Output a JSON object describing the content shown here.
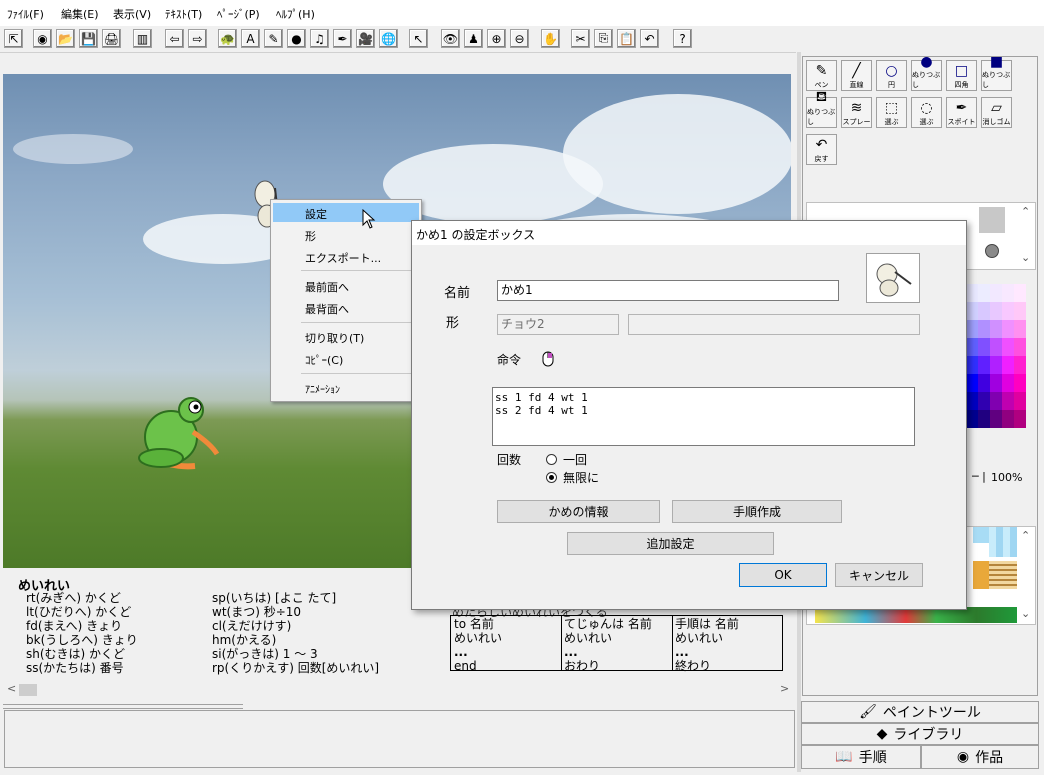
{
  "menu": [
    "ﾌｧｲﾙ(F)",
    "編集(E)",
    "表示(V)",
    "ﾃｷｽﾄ(T)",
    "ﾍﾟｰｼﾞ(P)",
    "ﾍﾙﾌﾟ(H)"
  ],
  "toolbar_icons": [
    "pointer-icon",
    "new-page-icon",
    "open-icon",
    "save-icon",
    "print-icon",
    "book-icon",
    "back-icon",
    "forward-icon",
    "turtle-icon",
    "text-icon",
    "paint-icon",
    "eye-icon",
    "music-icon",
    "pen-icon",
    "movie-icon",
    "globe-icon",
    "select-icon",
    "view-icon",
    "person-icon",
    "zoom-in-icon",
    "zoom-out-icon",
    "stop-icon",
    "cut-icon",
    "copy-icon",
    "paste-icon",
    "undo-icon",
    "help-icon"
  ],
  "toolbar_glyphs": [
    "⇱",
    "◉",
    "📂",
    "💾",
    "🖨",
    "▥",
    "⇦",
    "⇨",
    "🐢",
    "A",
    "✎",
    "●",
    "♫",
    "✒",
    "🎥",
    "🌐",
    "↖",
    "👁",
    "♟",
    "⊕",
    "⊖",
    "✋",
    "✂",
    "⎘",
    "📋",
    "↶",
    "?"
  ],
  "context_menu": {
    "items": [
      "設定",
      "形",
      "エクスポート...",
      "最前面へ",
      "最背面へ",
      "切り取り(T)",
      "ｺﾋﾟｰ(C)",
      "ｱﾆﾒｰｼｮﾝ"
    ]
  },
  "dialog": {
    "title": "かめ1 の設定ボックス",
    "name_label": "名前",
    "name_value": "かめ1",
    "shape_label": "形",
    "shape_value": "チョウ2",
    "command_label": "命令",
    "commands": [
      "ss 1 fd 4 wt 1",
      "ss 2 fd 4 wt 1"
    ],
    "count_label": "回数",
    "once_label": "一回",
    "forever_label": "無限に",
    "info_button": "かめの情報",
    "procedure_button": "手順作成",
    "extra_button": "追加設定",
    "ok_button": "OK",
    "cancel_button": "キャンセル"
  },
  "help": {
    "heading": "めいれい",
    "left": [
      "rt(みぎへ) かくど",
      "lt(ひだりへ) かくど",
      "fd(まえへ) きょり",
      "bk(うしろへ) きょり",
      "sh(むきは) かくど",
      "ss(かたちは) 番号"
    ],
    "middle": [
      "sp(いちは) [よこ たて]",
      "wt(まつ) 秒÷10",
      "cl(えだけけす)",
      "hm(かえる)",
      "si(がっきは) 1 ～ 3",
      "rp(くりかえす) 回数[めいれい]"
    ],
    "partial_line": "めたらしいめいれいをつくる",
    "table": [
      [
        "to 名前",
        "めいれい",
        "...",
        "end"
      ],
      [
        "てじゅんは 名前",
        "めいれい",
        "...",
        "おわり"
      ],
      [
        "手順は 名前",
        "めいれい",
        "...",
        "終わり"
      ]
    ]
  },
  "right_panel": {
    "tools": [
      {
        "label": "ペン",
        "icon": "pen-icon",
        "glyph": "✎"
      },
      {
        "label": "直線",
        "icon": "line-icon",
        "glyph": "╱"
      },
      {
        "label": "円",
        "icon": "circle-icon",
        "glyph": "○"
      },
      {
        "label": "ぬりつぶし",
        "icon": "filled-circle-icon",
        "glyph": "●"
      },
      {
        "label": "四角",
        "icon": "rect-icon",
        "glyph": "□"
      },
      {
        "label": "ぬりつぶし",
        "icon": "filled-rect-icon",
        "glyph": "■"
      },
      {
        "label": "ぬりつぶし",
        "icon": "fill-bucket-icon",
        "glyph": "⛾"
      },
      {
        "label": "スプレー",
        "icon": "spray-icon",
        "glyph": "≋"
      },
      {
        "label": "選ぶ",
        "icon": "select-rect-icon",
        "glyph": "⬚"
      },
      {
        "label": "選ぶ",
        "icon": "lasso-icon",
        "glyph": "◌"
      },
      {
        "label": "スポイト",
        "icon": "eyedropper-icon",
        "glyph": "✒"
      },
      {
        "label": "消しゴム",
        "icon": "eraser-icon",
        "glyph": "▱"
      },
      {
        "label": "戻す",
        "icon": "undo-icon",
        "glyph": "↶"
      }
    ],
    "zoom": "100%",
    "tabs": [
      "ペイントツール",
      "ライブラリ",
      "手順",
      "作品"
    ]
  },
  "colors": {
    "dialog_border": "#7a7a7a",
    "highlight": "#91c9f7"
  }
}
